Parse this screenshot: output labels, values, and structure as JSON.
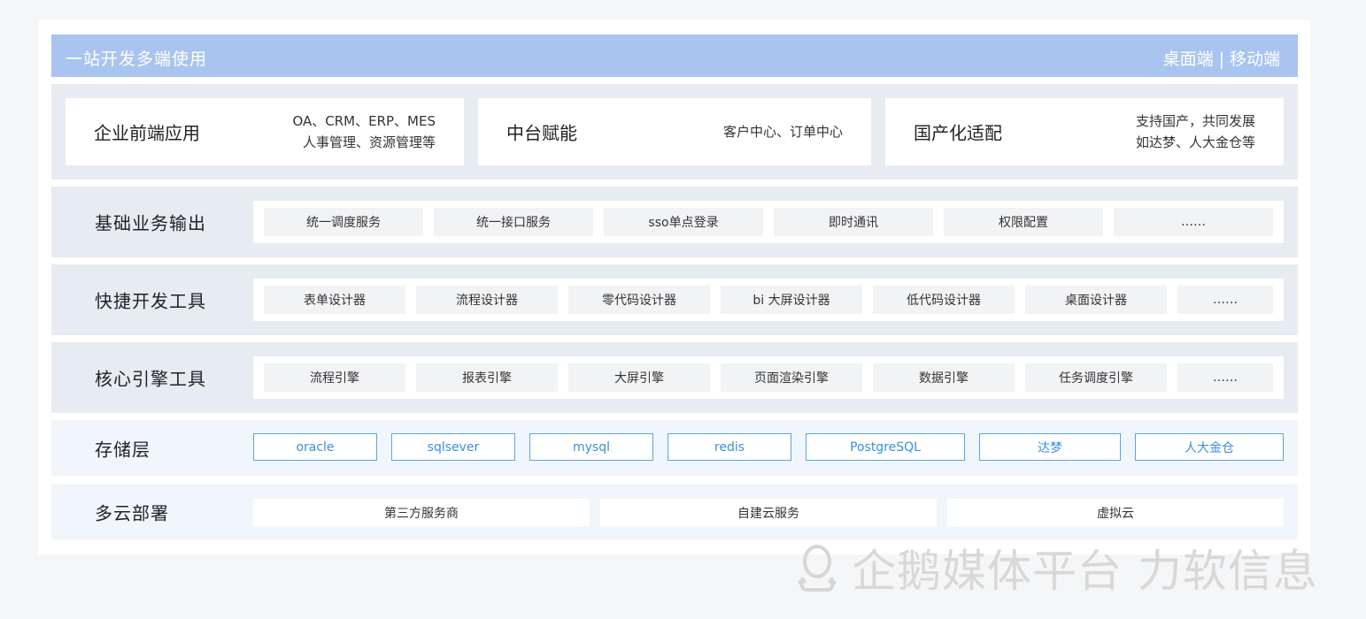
{
  "banner": {
    "title": "一站开发多端使用",
    "desktop": "桌面端",
    "separator": "|",
    "mobile": "移动端"
  },
  "cards": [
    {
      "title": "企业前端应用",
      "desc_line1": "OA、CRM、ERP、MES",
      "desc_line2": "人事管理、资源管理等"
    },
    {
      "title": "中台赋能",
      "desc_line1": "客户中心、订单中心",
      "desc_line2": ""
    },
    {
      "title": "国产化适配",
      "desc_line1": "支持国产，共同发展",
      "desc_line2": "如达梦、人大金仓等"
    }
  ],
  "rows": {
    "basic": {
      "label": "基础业务输出",
      "items": [
        "统一调度服务",
        "统一接口服务",
        "sso单点登录",
        "即时通讯",
        "权限配置",
        "……"
      ]
    },
    "devtools": {
      "label": "快捷开发工具",
      "items": [
        "表单设计器",
        "流程设计器",
        "零代码设计器",
        "bi 大屏设计器",
        "低代码设计器",
        "桌面设计器",
        "……"
      ]
    },
    "engines": {
      "label": "核心引擎工具",
      "items": [
        "流程引擎",
        "报表引擎",
        "大屏引擎",
        "页面渲染引擎",
        "数据引擎",
        "任务调度引擎",
        "……"
      ]
    },
    "storage": {
      "label": "存储层",
      "items": [
        "oracle",
        "sqlsever",
        "mysql",
        "redis",
        "PostgreSQL",
        "达梦",
        "人大金仓"
      ]
    },
    "cloud": {
      "label": "多云部署",
      "items": [
        "第三方服务商",
        "自建云服务",
        "虚拟云"
      ]
    }
  },
  "watermark": {
    "text": "企鹅媒体平台 力软信息"
  },
  "colors": {
    "banner": "#a9c4ef",
    "row_bg": "#e7ebf2",
    "cell_bg": "#f2f3f5",
    "storage_border": "#5aa2e6",
    "storage_text": "#3b8fdd",
    "light_row_bg": "#f1f6fd"
  }
}
